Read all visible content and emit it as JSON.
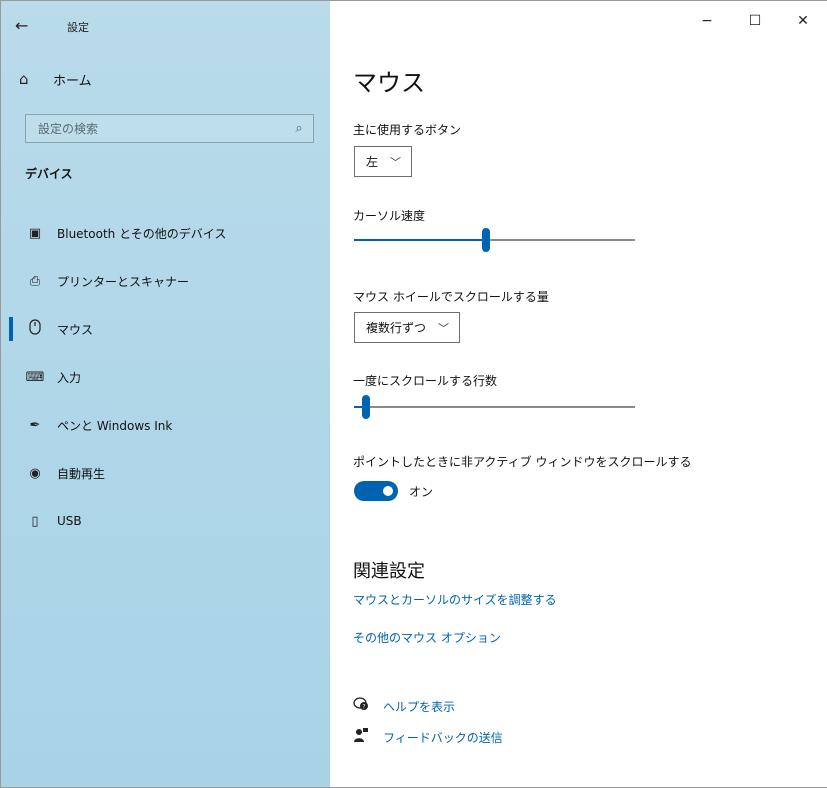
{
  "app": {
    "title": "設定"
  },
  "window": {
    "minimize": "−",
    "maximize": "☐",
    "close": "✕"
  },
  "sidebar": {
    "back_glyph": "←",
    "home": {
      "icon": "home-icon",
      "glyph": "⌂",
      "label": "ホーム"
    },
    "search": {
      "placeholder": "設定の検索",
      "glyph": "⌕"
    },
    "section": "デバイス",
    "items": [
      {
        "id": "bluetooth",
        "icon": "bluetooth-devices-icon",
        "glyph": "▣",
        "label": "Bluetooth とその他のデバイス"
      },
      {
        "id": "printers",
        "icon": "printer-icon",
        "glyph": "⎙",
        "label": "プリンターとスキャナー"
      },
      {
        "id": "mouse",
        "icon": "mouse-icon",
        "glyph": "⌂",
        "label": "マウス",
        "active": true
      },
      {
        "id": "input",
        "icon": "keyboard-icon",
        "glyph": "⌨",
        "label": "入力"
      },
      {
        "id": "pen",
        "icon": "pen-icon",
        "glyph": "✒",
        "label": "ペンと Windows Ink"
      },
      {
        "id": "autoplay",
        "icon": "autoplay-icon",
        "glyph": "◉",
        "label": "自動再生"
      },
      {
        "id": "usb",
        "icon": "usb-icon",
        "glyph": "▯",
        "label": "USB"
      }
    ]
  },
  "main": {
    "title": "マウス",
    "primary_button": {
      "label": "主に使用するボタン",
      "value": "左"
    },
    "cursor_speed": {
      "label": "カーソル速度",
      "level": 0.47
    },
    "wheel_scroll": {
      "label": "マウス ホイールでスクロールする量",
      "value": "複数行ずつ"
    },
    "lines_per_scroll": {
      "label": "一度にスクロールする行数",
      "level": 0.03
    },
    "inactive_scroll": {
      "label": "ポイントしたときに非アクティブ ウィンドウをスクロールする",
      "state": "オン"
    },
    "related": {
      "heading": "関連設定",
      "links": [
        "マウスとカーソルのサイズを調整する",
        "その他のマウス オプション"
      ]
    },
    "help": {
      "label": "ヘルプを表示"
    },
    "feedback": {
      "label": "フィードバックの送信"
    }
  },
  "colors": {
    "accent": "#0063b1",
    "sidebar": "#aed6e8"
  }
}
